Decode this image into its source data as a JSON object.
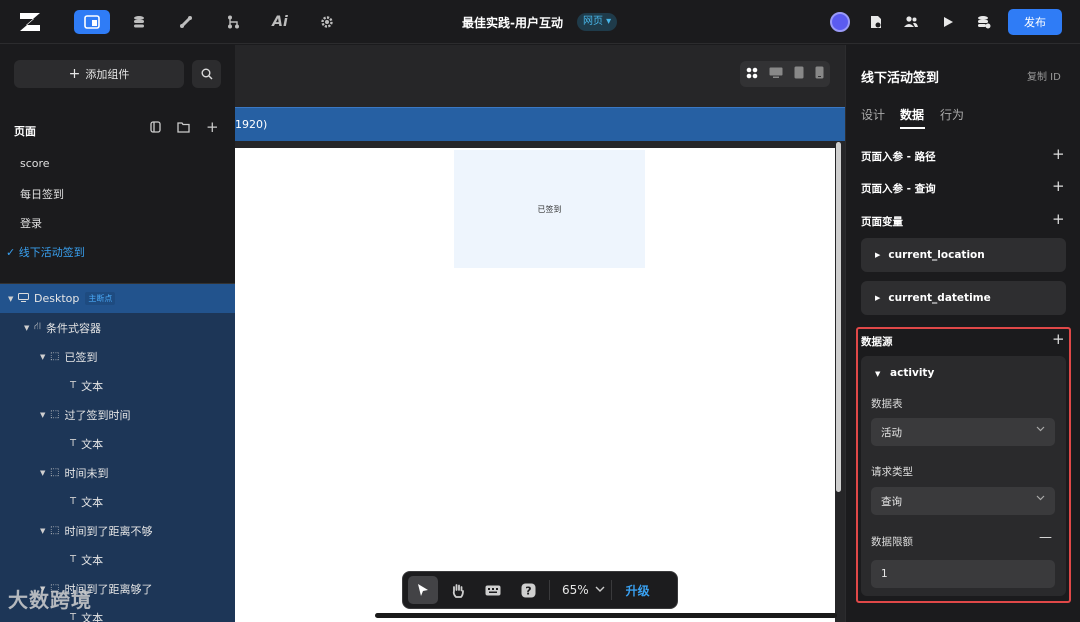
{
  "topbar": {
    "title": "最佳实践-用户互动",
    "badge": "网页 ▾",
    "publish_label": "发布",
    "colors": {
      "accent": "#2f7cf6",
      "bg": "#1b1b1d"
    },
    "nav_icons": [
      "pages-icon",
      "database-icon",
      "plugin-icon",
      "workflow-icon",
      "ai-icon",
      "settings-icon"
    ],
    "nav_ai_label": "Ai"
  },
  "left": {
    "add_component_label": "添加组件",
    "pages_header": "页面",
    "pages": [
      "score",
      "每日签到",
      "登录",
      "线下活动签到"
    ],
    "active_page_check": "✓",
    "tree": [
      {
        "label": "Desktop",
        "tag": "主断点",
        "level": 0,
        "type": "desktop"
      },
      {
        "label": "条件式容器",
        "level": 1,
        "type": "condition"
      },
      {
        "label": "已签到",
        "level": 2,
        "type": "container"
      },
      {
        "label": "文本",
        "level": 3,
        "type": "text"
      },
      {
        "label": "过了签到时间",
        "level": 2,
        "type": "container"
      },
      {
        "label": "文本",
        "level": 3,
        "type": "text"
      },
      {
        "label": "时间未到",
        "level": 2,
        "type": "container"
      },
      {
        "label": "文本",
        "level": 3,
        "type": "text"
      },
      {
        "label": "时间到了距离不够",
        "level": 2,
        "type": "container"
      },
      {
        "label": "文本",
        "level": 3,
        "type": "text"
      },
      {
        "label": "时间到了距离够了",
        "level": 2,
        "type": "container"
      },
      {
        "label": "文本",
        "level": 3,
        "type": "text"
      }
    ]
  },
  "canvas": {
    "frame_label": "1920)",
    "signed_text": "已签到",
    "zoom": "65%",
    "upgrade_label": "升级"
  },
  "watermark": "大数跨境",
  "right": {
    "title": "线下活动签到",
    "copy_id": "复制 ID",
    "tabs": [
      "设计",
      "数据",
      "行为"
    ],
    "active_tab": "数据",
    "sections": {
      "params_path": "页面入参 - 路径",
      "params_query": "页面入参 - 查询",
      "page_vars": "页面变量",
      "datasource": "数据源"
    },
    "variables": [
      "current_location",
      "current_datetime"
    ],
    "datasource": {
      "name": "activity",
      "table_label": "数据表",
      "table_value": "活动",
      "request_type_label": "请求类型",
      "request_type_value": "查询",
      "limit_label": "数据限额",
      "limit_value": "1"
    }
  }
}
